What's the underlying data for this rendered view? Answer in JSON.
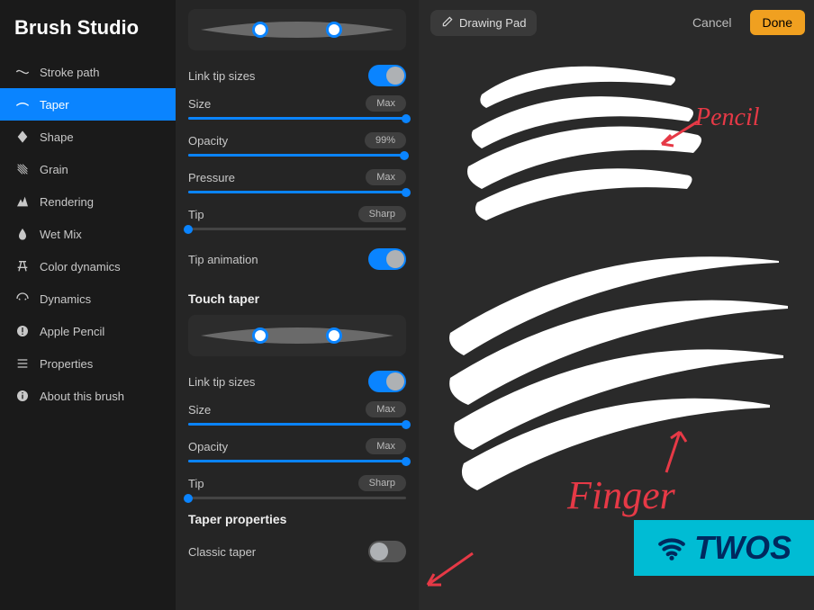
{
  "app": {
    "title": "Brush Studio"
  },
  "topbar": {
    "drawing_pad": "Drawing Pad",
    "cancel": "Cancel",
    "done": "Done"
  },
  "sidebar": {
    "items": [
      {
        "label": "Stroke path",
        "icon": "stroke-path-icon"
      },
      {
        "label": "Taper",
        "icon": "taper-icon"
      },
      {
        "label": "Shape",
        "icon": "shape-icon"
      },
      {
        "label": "Grain",
        "icon": "grain-icon"
      },
      {
        "label": "Rendering",
        "icon": "rendering-icon"
      },
      {
        "label": "Wet Mix",
        "icon": "wet-mix-icon"
      },
      {
        "label": "Color dynamics",
        "icon": "color-dynamics-icon"
      },
      {
        "label": "Dynamics",
        "icon": "dynamics-icon"
      },
      {
        "label": "Apple Pencil",
        "icon": "apple-pencil-icon"
      },
      {
        "label": "Properties",
        "icon": "properties-icon"
      },
      {
        "label": "About this brush",
        "icon": "about-icon"
      }
    ],
    "active_index": 1
  },
  "settings": {
    "pencil_taper": {
      "link_tip_sizes": {
        "label": "Link tip sizes",
        "on": true
      },
      "handles": {
        "left_pct": 33,
        "right_pct": 67
      },
      "sliders": [
        {
          "key": "size",
          "label": "Size",
          "value_label": "Max",
          "pct": 100
        },
        {
          "key": "opacity",
          "label": "Opacity",
          "value_label": "99%",
          "pct": 99
        },
        {
          "key": "pressure",
          "label": "Pressure",
          "value_label": "Max",
          "pct": 100
        },
        {
          "key": "tip",
          "label": "Tip",
          "value_label": "Sharp",
          "pct": 0
        }
      ],
      "tip_animation": {
        "label": "Tip animation",
        "on": true
      }
    },
    "touch_taper": {
      "heading": "Touch taper",
      "link_tip_sizes": {
        "label": "Link tip sizes",
        "on": true
      },
      "handles": {
        "left_pct": 33,
        "right_pct": 67
      },
      "sliders": [
        {
          "key": "size",
          "label": "Size",
          "value_label": "Max",
          "pct": 100
        },
        {
          "key": "opacity",
          "label": "Opacity",
          "value_label": "Max",
          "pct": 100
        },
        {
          "key": "tip",
          "label": "Tip",
          "value_label": "Sharp",
          "pct": 0
        }
      ]
    },
    "taper_properties": {
      "heading": "Taper properties",
      "classic_taper": {
        "label": "Classic taper",
        "on": false
      }
    }
  },
  "annotations": {
    "pencil": "Pencil",
    "finger": "Finger"
  },
  "logo": {
    "text": "TWOS"
  }
}
